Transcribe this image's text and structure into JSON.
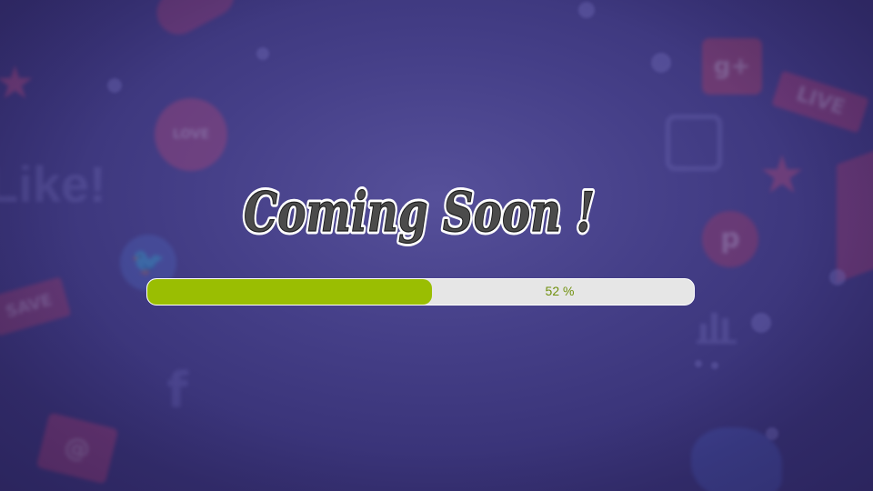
{
  "page": {
    "title": "Coming Soon !"
  },
  "progress": {
    "value": 0.52,
    "label": "52 %",
    "fill_color": "#9abe02",
    "track_color": "#e6e6e6",
    "label_color": "#6f8f0c"
  },
  "theme": {
    "background": "#463f8a",
    "title_fill": "#4b4b4b",
    "title_outline": "#ffffff"
  },
  "background_icons": {
    "like_text": "Like!",
    "live_text": "LIVE",
    "save_text": "SAVE",
    "gplus_text": "g+",
    "pinterest_text": "p",
    "facebook_text": "f",
    "heart_badge_text": "LOVE",
    "mail_text": "@",
    "star": "★",
    "bird": "🐦"
  }
}
